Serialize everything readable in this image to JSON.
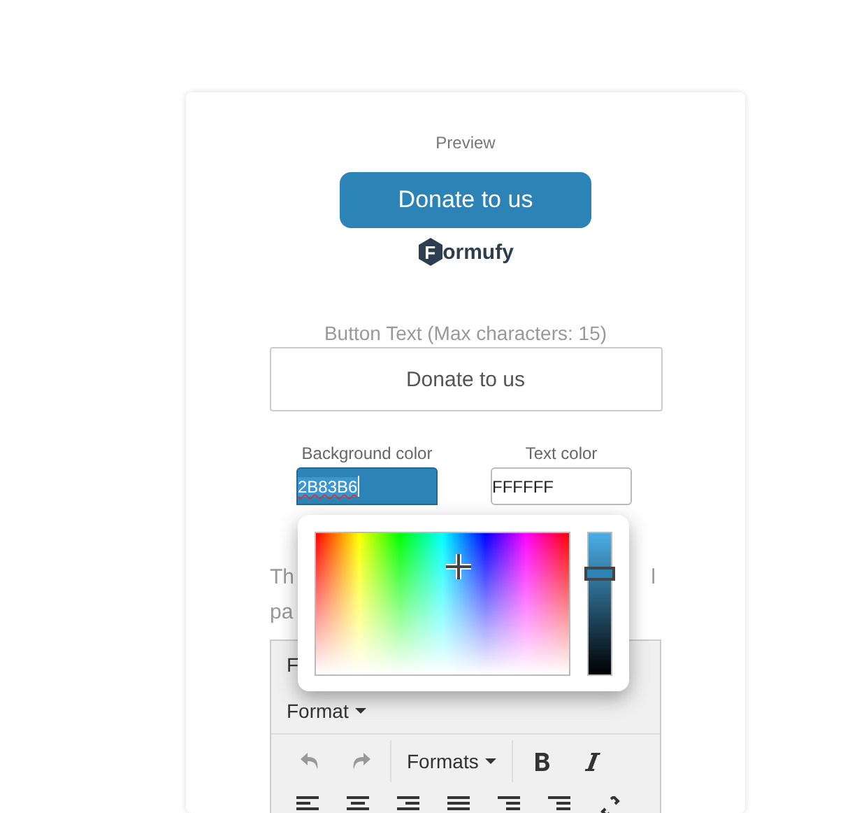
{
  "preview": {
    "label": "Preview",
    "button_text": "Donate to us",
    "brand": {
      "initial": "F",
      "rest": "ormufy"
    }
  },
  "button_text_field": {
    "label": "Button Text (Max characters: 15)",
    "value": "Donate to us"
  },
  "colors": [
    {
      "label": "Background color",
      "value": "2B83B6",
      "text_selected": true,
      "picker_open": true,
      "level": 0.71
    },
    {
      "label": "Text color",
      "value": "FFFFFF",
      "text_selected": false,
      "picker_open": false
    }
  ],
  "description": {
    "line_1_start": "Th",
    "line_1_end": "l",
    "line_2_start": "pa"
  },
  "editor": {
    "menu_start": "F",
    "format_menu": "Format",
    "formats_dropdown": "Formats",
    "undo_disabled": true,
    "redo_disabled": true
  }
}
